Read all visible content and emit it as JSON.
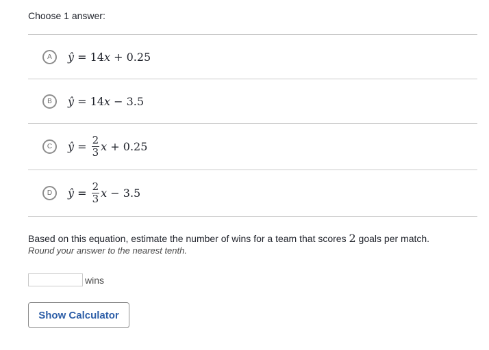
{
  "prompt": "Choose 1 answer:",
  "choices": [
    {
      "letter": "A",
      "lhs": "ŷ",
      "eq": " = ",
      "coef": "14",
      "var": "x",
      "op": " + ",
      "const": "0.25"
    },
    {
      "letter": "B",
      "lhs": "ŷ",
      "eq": " = ",
      "coef": "14",
      "var": "x",
      "op": " − ",
      "const": "3.5"
    },
    {
      "letter": "C",
      "lhs": "ŷ",
      "eq": " = ",
      "num": "2",
      "den": "3",
      "var": "x",
      "op": " + ",
      "const": "0.25"
    },
    {
      "letter": "D",
      "lhs": "ŷ",
      "eq": " = ",
      "num": "2",
      "den": "3",
      "var": "x",
      "op": " − ",
      "const": "3.5"
    }
  ],
  "question": {
    "before": "Based on this equation, estimate the number of wins for a team that scores ",
    "value": "2",
    "after": " goals per match.",
    "hint": "Round your answer to the nearest tenth."
  },
  "answer": {
    "value": "",
    "placeholder": "",
    "unit": "wins"
  },
  "calculator_button": "Show Calculator"
}
